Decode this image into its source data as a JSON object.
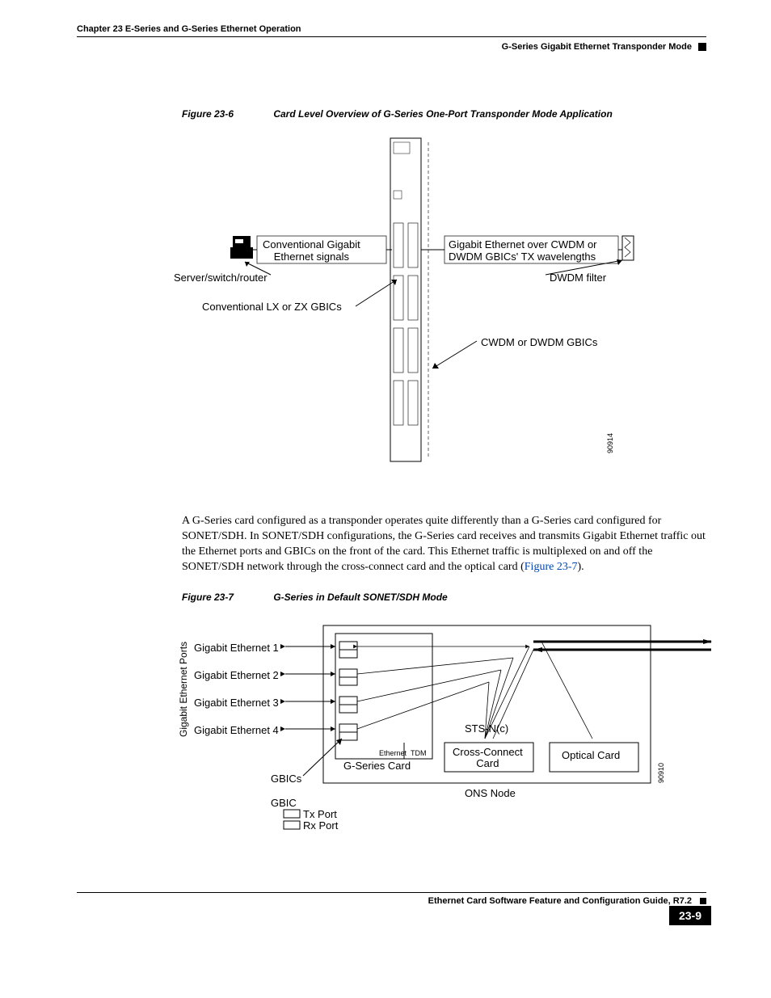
{
  "header": {
    "chapter": "Chapter 23 E-Series and G-Series Ethernet Operation",
    "section": "G-Series Gigabit Ethernet Transponder Mode"
  },
  "figure1": {
    "num": "Figure 23-6",
    "title": "Card Level Overview of G-Series One-Port Transponder Mode Application",
    "callouts": {
      "conv_sig": "Conventional Gigabit\nEthernet signals",
      "server": "Server/switch/router",
      "conv_gbics": "Conventional LX or ZX GBICs",
      "over": "Gigabit Ethernet over CWDM or\nDWDM GBICs' TX wavelengths",
      "dwdm": "DWDM filter",
      "cwdm": "CWDM or DWDM GBICs"
    },
    "side_num": "90914"
  },
  "paragraph": {
    "text_a": "A G-Series card configured as a transponder operates quite differently than a G-Series card configured for SONET/SDH. In SONET/SDH configurations, the G-Series card receives and transmits Gigabit Ethernet traffic out the Ethernet ports and GBICs on the front of the card. This Ethernet traffic is multiplexed on and off the SONET/SDH network through the cross-connect card and the optical card (",
    "xref": "Figure 23-7",
    "text_b": ")."
  },
  "figure2": {
    "num": "Figure 23-7",
    "title": "G-Series in Default SONET/SDH Mode",
    "callouts": {
      "vert": "Gigabit Ethernet Ports",
      "ge1": "Gigabit Ethernet 1",
      "ge2": "Gigabit Ethernet 2",
      "ge3": "Gigabit Ethernet 3",
      "ge4": "Gigabit Ethernet 4",
      "gbics": "GBICs",
      "gbic": "GBIC",
      "tx": "Tx Port",
      "rx": "Rx Port",
      "ethernet": "Ethernet",
      "tdm": "TDM",
      "gseries": "G-Series Card",
      "sts": "STS-N(c)",
      "cross": "Cross-Connect\nCard",
      "optical": "Optical Card",
      "ons": "ONS Node"
    },
    "side_num": "90910"
  },
  "footer": {
    "guide": "Ethernet Card Software Feature and Configuration Guide, R7.2",
    "page": "23-9"
  }
}
